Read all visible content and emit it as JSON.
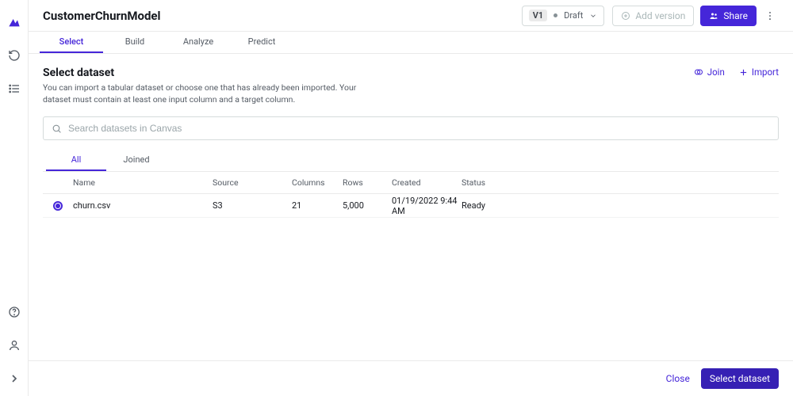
{
  "header": {
    "title": "CustomerChurnModel",
    "version": "V1",
    "status": "Draft",
    "add_version": "Add version",
    "share": "Share"
  },
  "tabs": [
    "Select",
    "Build",
    "Analyze",
    "Predict"
  ],
  "active_tab": 0,
  "page": {
    "title": "Select dataset",
    "description": "You can import a tabular dataset or choose one that has already been imported. Your dataset must contain at least one input column and a target column."
  },
  "actions": {
    "join": "Join",
    "import": "Import"
  },
  "search": {
    "placeholder": "Search datasets in Canvas"
  },
  "subtabs": [
    "All",
    "Joined"
  ],
  "active_subtab": 0,
  "table": {
    "headers": [
      "Name",
      "Source",
      "Columns",
      "Rows",
      "Created",
      "Status"
    ],
    "rows": [
      {
        "name": "churn.csv",
        "source": "S3",
        "columns": "21",
        "rows": "5,000",
        "created": "01/19/2022 9:44 AM",
        "status": "Ready",
        "selected": true
      }
    ]
  },
  "footer": {
    "close": "Close",
    "select": "Select dataset"
  }
}
